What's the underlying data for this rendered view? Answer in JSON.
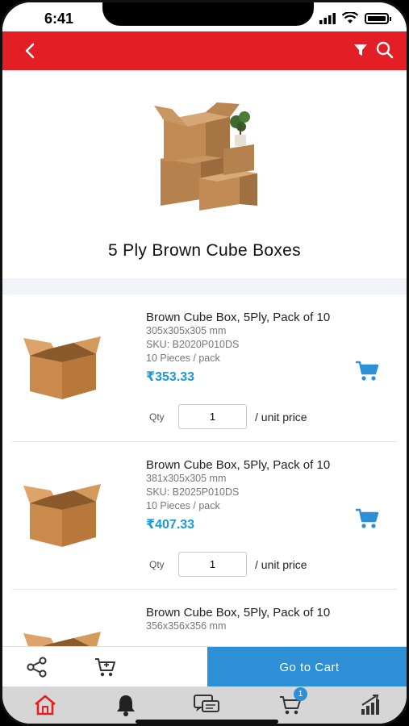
{
  "status_bar": {
    "time": "6:41"
  },
  "header": {
    "back_icon": "chevron-left-icon",
    "filter_icon": "filter-icon",
    "search_icon": "search-icon"
  },
  "hero": {
    "title": "5 Ply Brown Cube Boxes"
  },
  "products": [
    {
      "name": "Brown Cube Box, 5Ply, Pack of 10",
      "size": "305x305x305 mm",
      "sku": "SKU: B2020P010DS",
      "pack": "10 Pieces / pack",
      "price": "₹353.33",
      "qty_label": "Qty",
      "qty": "1",
      "unit_label": "/ unit price"
    },
    {
      "name": "Brown Cube Box, 5Ply, Pack of 10",
      "size": "381x305x305 mm",
      "sku": "SKU: B2025P010DS",
      "pack": "10 Pieces / pack",
      "price": "₹407.33",
      "qty_label": "Qty",
      "qty": "1",
      "unit_label": "/ unit price"
    },
    {
      "name": "Brown Cube Box, 5Ply, Pack of 10",
      "size": "356x356x356 mm"
    }
  ],
  "action_bar": {
    "go_to_cart": "Go to Cart"
  },
  "tab_bar": {
    "cart_badge": "1"
  },
  "colors": {
    "brand_red": "#e31e24",
    "accent_blue": "#2d8fd6",
    "price_blue": "#1b9ad8"
  }
}
